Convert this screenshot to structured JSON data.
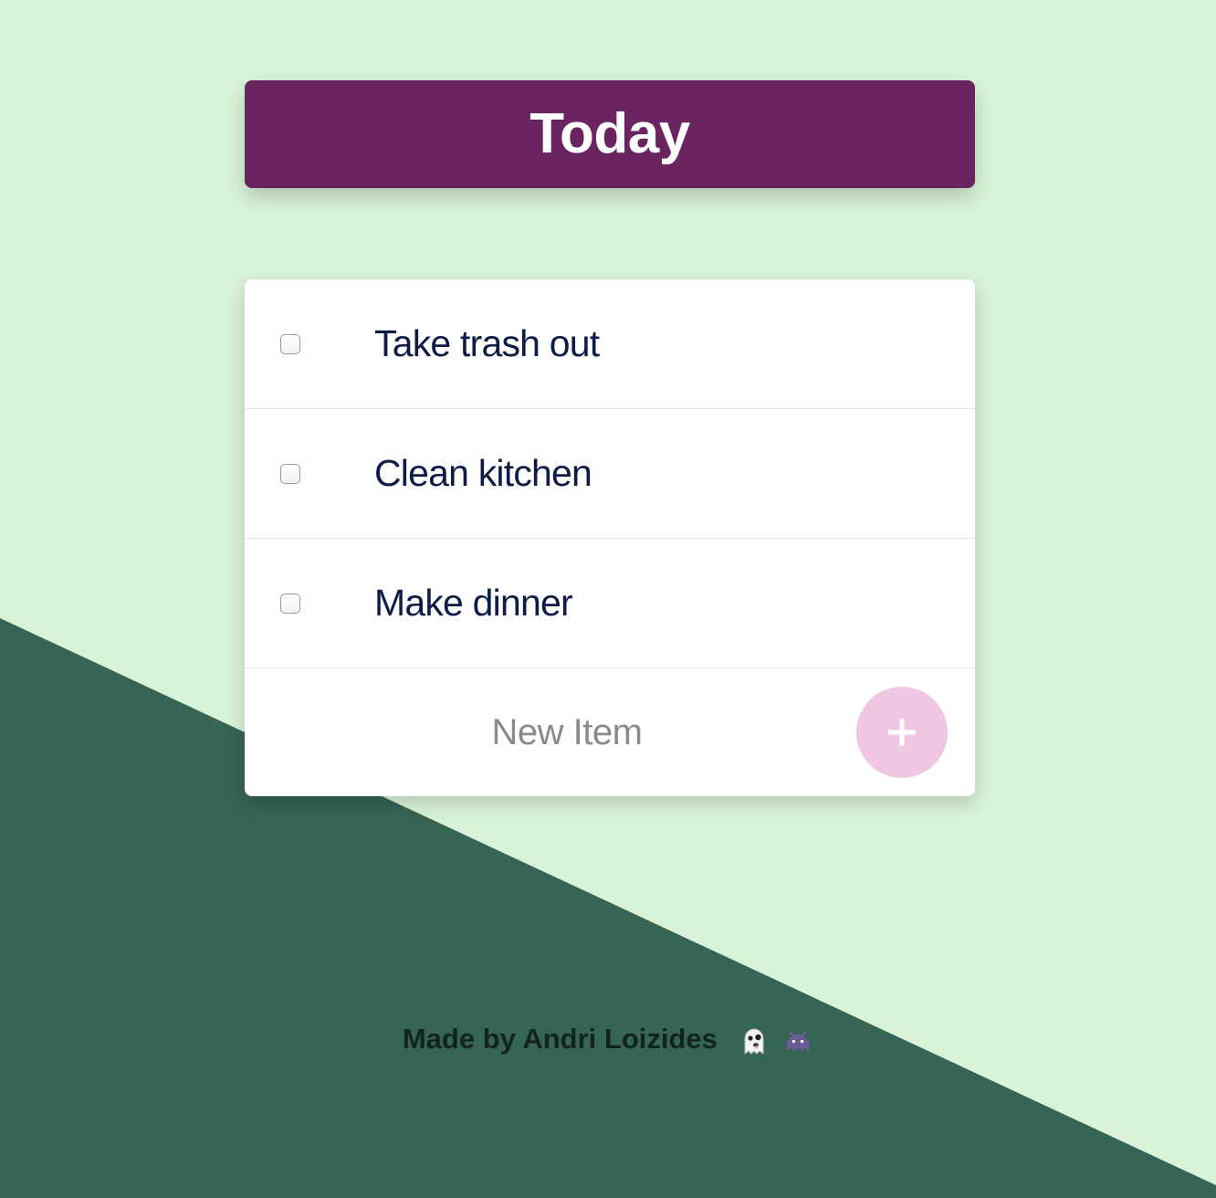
{
  "header": {
    "title": "Today"
  },
  "todos": [
    {
      "text": "Take trash out",
      "checked": false
    },
    {
      "text": "Clean kitchen",
      "checked": false
    },
    {
      "text": "Make dinner",
      "checked": false
    }
  ],
  "new_item": {
    "placeholder": "New Item",
    "value": "",
    "add_icon": "plus-icon"
  },
  "footer": {
    "text": "Made by Andri Loizides",
    "icons": [
      "ghost-icon",
      "alien-monster-icon"
    ]
  },
  "colors": {
    "background_light": "#d8f3d7",
    "background_dark": "#366455",
    "header": "#6a2561",
    "todo_text": "#0d1b46",
    "add_button": "#efc7e4"
  }
}
